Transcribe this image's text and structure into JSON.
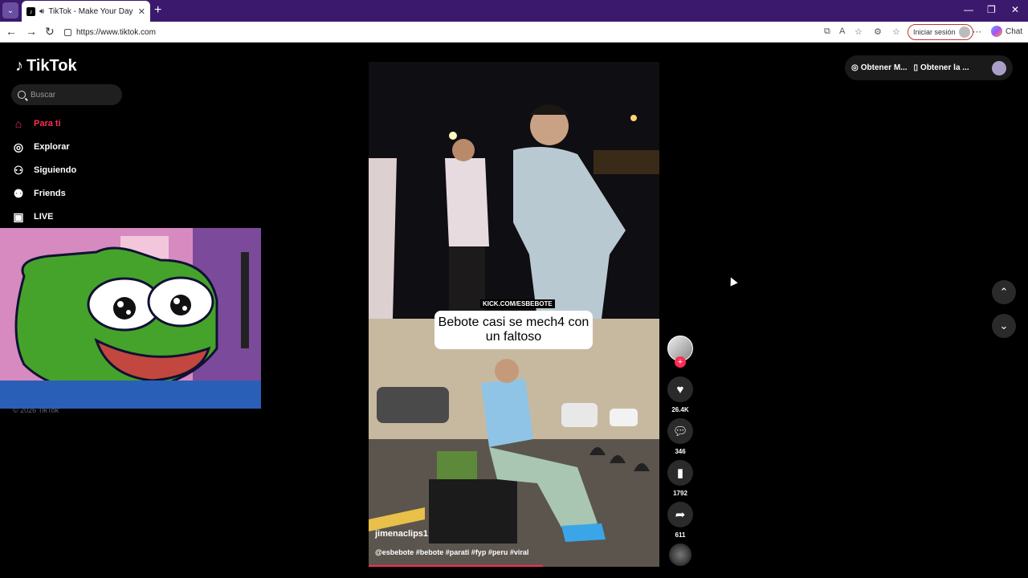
{
  "browser": {
    "tab_title": "TikTok - Make Your Day",
    "new_tab_label": "+",
    "url": "https://www.tiktok.com",
    "signin_label": "Iniciar sesión",
    "chat_label": "Chat"
  },
  "sidebar": {
    "logo": "TikTok",
    "search_placeholder": "Buscar",
    "items": [
      {
        "label": "Para ti",
        "icon": "home-icon",
        "active": true
      },
      {
        "label": "Explorar",
        "icon": "compass-icon",
        "active": false
      },
      {
        "label": "Siguiendo",
        "icon": "following-icon",
        "active": false
      },
      {
        "label": "Friends",
        "icon": "friends-icon",
        "active": false
      },
      {
        "label": "LIVE",
        "icon": "live-icon",
        "active": false
      }
    ],
    "copyright": "© 2026 TikTok"
  },
  "video": {
    "caption": "Bebote casi se mech4 con un faltoso",
    "watermark": "KICK.COM/ESBEBOTE",
    "author": "jimenaclips1",
    "description": "@esbebote #bebote #parati #fyp #peru #viral",
    "progress": 0.6
  },
  "actions": {
    "likes": "26.4K",
    "comments": "346",
    "saves": "1792",
    "shares": "611"
  },
  "topbar": {
    "get_coins": "Obtener M...",
    "get_app": "Obtener la ..."
  },
  "colors": {
    "accent": "#fe2c55",
    "background": "#000000",
    "browser_chrome": "#3b1a6e"
  }
}
